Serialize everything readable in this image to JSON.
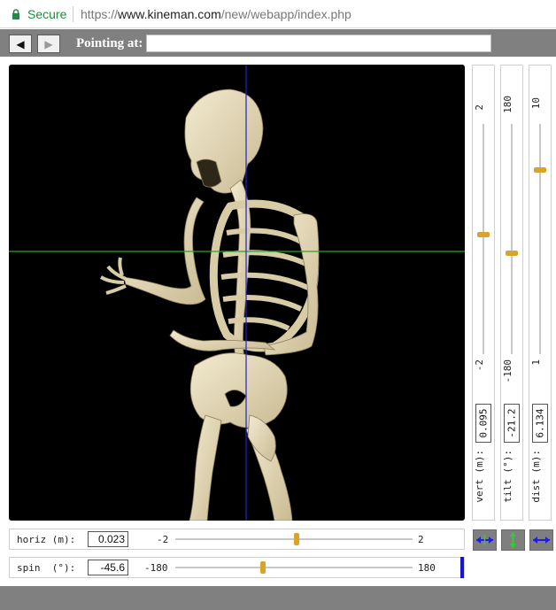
{
  "address_bar": {
    "secure_label": "Secure",
    "url_prefix": "https://",
    "url_host": "www.kineman.com",
    "url_path": "/new/webapp/index.php"
  },
  "toolbar": {
    "back_glyph": "◀",
    "forward_glyph": "▶",
    "pointing_label": "Pointing at:",
    "pointing_value": ""
  },
  "viewport": {
    "background": "#000000",
    "horizontal_axis_color": "#2aa52a",
    "vertical_axis_color": "#2222cc",
    "subject": "skeleton"
  },
  "sliders": {
    "vert": {
      "label": "vert (m):",
      "min": "-2",
      "max": "2",
      "value": "0.095",
      "fraction": 0.52
    },
    "tilt": {
      "label": "tilt (°):",
      "min": "-180",
      "max": "180",
      "value": "-21.2",
      "fraction": 0.44
    },
    "dist": {
      "label": "dist (m):",
      "min": "1",
      "max": "10",
      "value": "6.134",
      "fraction": 0.8
    },
    "horiz": {
      "label": "horiz (m):",
      "min": "-2",
      "max": "2",
      "value": "0.023",
      "fraction": 0.51
    },
    "spin": {
      "label": "spin  (°):",
      "min": "-180",
      "max": "180",
      "value": "-45.6",
      "fraction": 0.37
    }
  },
  "mode_buttons": [
    {
      "icon": "horizontal-arrows-icon"
    },
    {
      "icon": "vertical-arrows-icon"
    },
    {
      "icon": "depth-arrows-icon"
    }
  ],
  "colors": {
    "accent_thumb": "#d9a42b",
    "tilt_indicator": "#33cc33",
    "spin_indicator": "#1515d0",
    "toolbar_gray": "#808080"
  }
}
